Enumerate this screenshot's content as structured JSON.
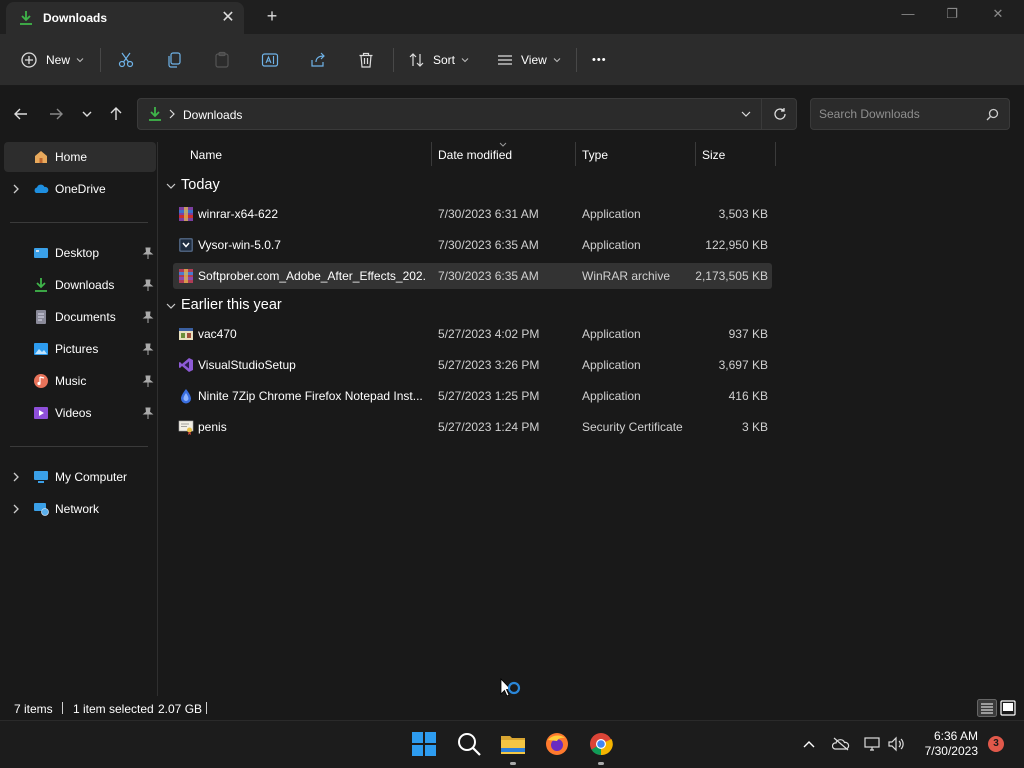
{
  "window": {
    "tab_title": "Downloads",
    "close_tab_glyph": "✕",
    "new_tab_glyph": "+",
    "minimize_glyph": "—",
    "restore_glyph": "❐",
    "close_glyph": "✕"
  },
  "toolbar": {
    "new_label": "New",
    "sort_label": "Sort",
    "view_label": "View",
    "more_glyph": "•••"
  },
  "address": {
    "path_segment": "Downloads",
    "search_placeholder": "Search Downloads"
  },
  "sidebar": {
    "items": [
      {
        "label": "Home",
        "icon": "home-icon",
        "selected": true
      },
      {
        "label": "OneDrive",
        "icon": "onedrive-icon",
        "expandable": true
      },
      {
        "label": "Desktop",
        "icon": "desktop-icon",
        "pinned": true
      },
      {
        "label": "Downloads",
        "icon": "downloads-icon",
        "pinned": true
      },
      {
        "label": "Documents",
        "icon": "documents-icon",
        "pinned": true
      },
      {
        "label": "Pictures",
        "icon": "pictures-icon",
        "pinned": true
      },
      {
        "label": "Music",
        "icon": "music-icon",
        "pinned": true
      },
      {
        "label": "Videos",
        "icon": "videos-icon",
        "pinned": true
      },
      {
        "label": "My Computer",
        "icon": "computer-icon",
        "expandable": true
      },
      {
        "label": "Network",
        "icon": "network-icon",
        "expandable": true
      }
    ]
  },
  "columns": {
    "name": "Name",
    "date": "Date modified",
    "type": "Type",
    "size": "Size"
  },
  "groups": [
    {
      "label": "Today",
      "files": [
        {
          "name": "winrar-x64-622",
          "date": "7/30/2023 6:31 AM",
          "type": "Application",
          "size": "3,503 KB",
          "icon": "winrar-icon"
        },
        {
          "name": "Vysor-win-5.0.7",
          "date": "7/30/2023 6:35 AM",
          "type": "Application",
          "size": "122,950 KB",
          "icon": "installer-icon"
        },
        {
          "name": "Softprober.com_Adobe_After_Effects_202...",
          "date": "7/30/2023 6:35 AM",
          "type": "WinRAR archive",
          "size": "2,173,505 KB",
          "icon": "winrar-archive-icon",
          "selected": true
        }
      ]
    },
    {
      "label": "Earlier this year",
      "files": [
        {
          "name": "vac470",
          "date": "5/27/2023 4:02 PM",
          "type": "Application",
          "size": "937 KB",
          "icon": "app-icon"
        },
        {
          "name": "VisualStudioSetup",
          "date": "5/27/2023 3:26 PM",
          "type": "Application",
          "size": "3,697 KB",
          "icon": "visual-studio-icon"
        },
        {
          "name": "Ninite 7Zip Chrome Firefox Notepad Inst...",
          "date": "5/27/2023 1:25 PM",
          "type": "Application",
          "size": "416 KB",
          "icon": "ninite-icon"
        },
        {
          "name": "penis",
          "date": "5/27/2023 1:24 PM",
          "type": "Security Certificate",
          "size": "3 KB",
          "icon": "certificate-icon"
        }
      ]
    }
  ],
  "status": {
    "item_count": "7 items",
    "selection": "1 item selected",
    "selection_size": "2.07 GB"
  },
  "taskbar": {
    "time": "6:36 AM",
    "date": "7/30/2023",
    "notification_count": "3"
  },
  "colors": {
    "accent_green": "#3fb54a",
    "folder_yellow": "#f2c037",
    "notification_red": "#e0584a"
  }
}
